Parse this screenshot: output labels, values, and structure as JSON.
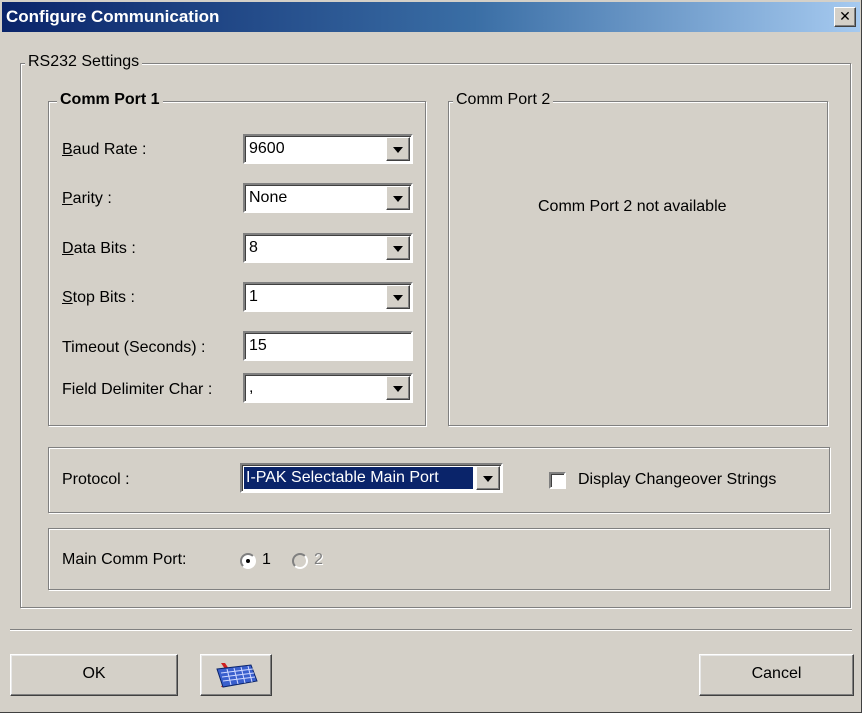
{
  "window": {
    "title": "Configure Communication",
    "close_glyph": "✕"
  },
  "rs232": {
    "legend": "RS232 Settings",
    "port1": {
      "legend": "Comm Port 1",
      "baud_rate": {
        "label_key": "B",
        "label_rest": "aud Rate :",
        "value": "9600"
      },
      "parity": {
        "label_key": "P",
        "label_rest": "arity :",
        "value": "None"
      },
      "data_bits": {
        "label_key": "D",
        "label_rest": "ata Bits :",
        "value": "8"
      },
      "stop_bits": {
        "label_key": "S",
        "label_rest": "top Bits :",
        "value": "1"
      },
      "timeout": {
        "label": "Timeout (Seconds) :",
        "value": "15"
      },
      "delimiter": {
        "label": "Field Delimiter Char :",
        "value": ","
      }
    },
    "port2": {
      "legend": "Comm Port 2",
      "message": "Comm Port 2 not available"
    },
    "protocol": {
      "label": "Protocol :",
      "value": "I-PAK Selectable Main Port",
      "display_changeover_label": "Display Changeover Strings",
      "display_changeover_checked": false
    },
    "main_comm_port": {
      "label": "Main Comm Port:",
      "option1": "1",
      "option2": "2",
      "selected": "1"
    }
  },
  "buttons": {
    "ok": "OK",
    "cancel": "Cancel",
    "keyboard_icon": "keyboard-icon"
  }
}
